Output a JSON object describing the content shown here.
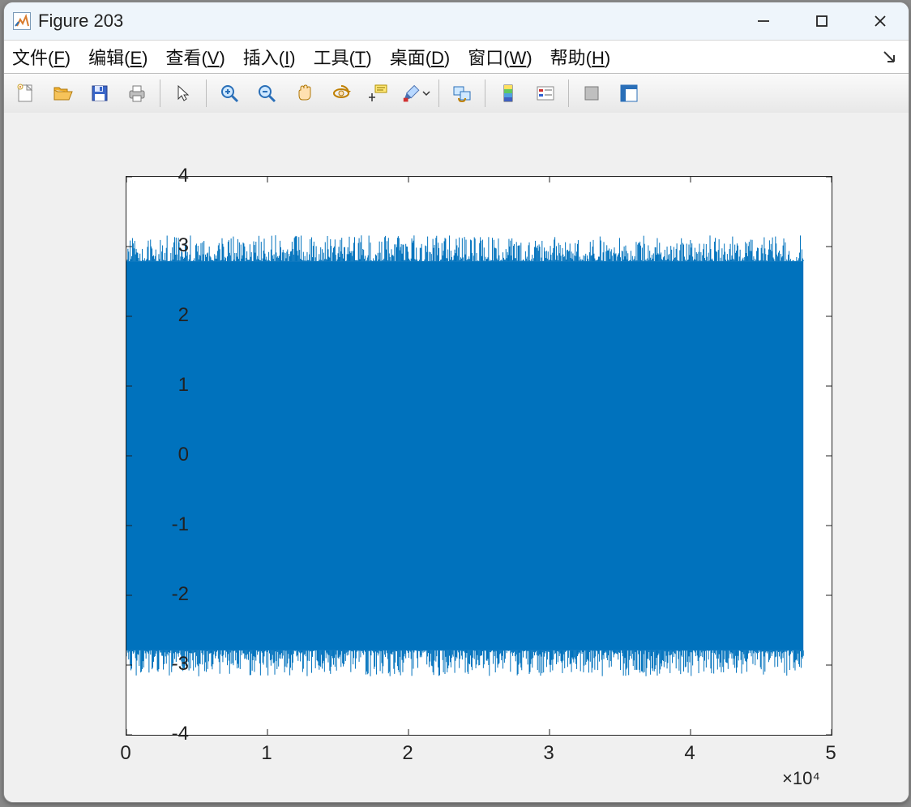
{
  "window": {
    "title": "Figure 203"
  },
  "menu": {
    "items": [
      {
        "pre": "文件(",
        "u": "F",
        "post": ")"
      },
      {
        "pre": "编辑(",
        "u": "E",
        "post": ")"
      },
      {
        "pre": "查看(",
        "u": "V",
        "post": ")"
      },
      {
        "pre": "插入(",
        "u": "I",
        "post": ")"
      },
      {
        "pre": "工具(",
        "u": "T",
        "post": ")"
      },
      {
        "pre": "桌面(",
        "u": "D",
        "post": ")"
      },
      {
        "pre": "窗口(",
        "u": "W",
        "post": ")"
      },
      {
        "pre": "帮助(",
        "u": "H",
        "post": ")"
      }
    ]
  },
  "toolbar": {
    "icons": [
      "new-figure-icon",
      "open-icon",
      "save-icon",
      "print-icon",
      "sep",
      "pointer-icon",
      "sep",
      "zoom-in-icon",
      "zoom-out-icon",
      "pan-icon",
      "rotate-3d-icon",
      "data-cursor-icon",
      "brush-icon",
      "sep",
      "link-plot-icon",
      "sep",
      "colorbar-icon",
      "legend-icon",
      "sep",
      "hide-plot-tools-icon",
      "show-plot-tools-icon"
    ]
  },
  "chart_data": {
    "type": "line",
    "description": "Dense oscillating signal (appears as a solid filled band) ranging roughly from -3.1 to 3.1 across the full x range",
    "x_range": [
      0,
      48000
    ],
    "y_range_data": [
      -3.1,
      3.1
    ],
    "n_samples_approx": 48000,
    "color": "#0072bd",
    "title": "",
    "xlabel": "",
    "ylabel": "",
    "x_ticks": [
      0,
      10000,
      20000,
      30000,
      40000,
      50000
    ],
    "x_tick_labels": [
      "0",
      "1",
      "2",
      "3",
      "4",
      "5"
    ],
    "x_exponent_label": "×10⁴",
    "y_ticks": [
      -4,
      -3,
      -2,
      -1,
      0,
      1,
      2,
      3,
      4
    ],
    "y_tick_labels": [
      "-4",
      "-3",
      "-2",
      "-1",
      "0",
      "1",
      "2",
      "3",
      "4"
    ],
    "xlim": [
      0,
      50000
    ],
    "ylim": [
      -4,
      4
    ]
  }
}
